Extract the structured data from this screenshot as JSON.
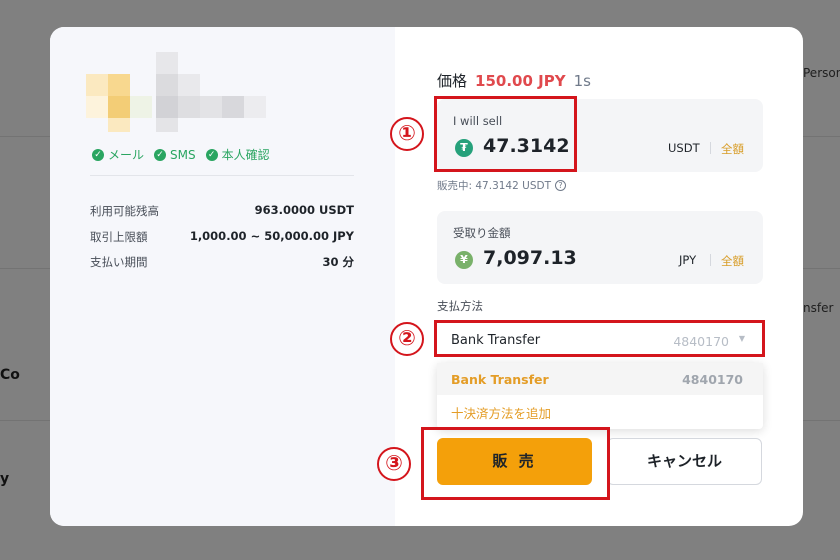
{
  "background": {
    "top_right_text": "Person",
    "mid_right_text": "nsfer",
    "left_text_1": "Co",
    "left_text_2": "y"
  },
  "merchant": {
    "verifications": [
      "メール",
      "SMS",
      "本人確認"
    ],
    "info": [
      {
        "label": "利用可能残高",
        "value": "963.0000 USDT"
      },
      {
        "label": "取引上限額",
        "value": "1,000.00 ~ 50,000.00 JPY"
      },
      {
        "label": "支払い期間",
        "value": "30 分"
      }
    ]
  },
  "price": {
    "label": "価格",
    "value": "150.00 JPY",
    "timer": "1s"
  },
  "sell_field": {
    "label": "I will sell",
    "coin_icon": "tether-icon",
    "amount": "47.3142",
    "unit": "USDT",
    "all_label": "全額",
    "hint": "販売中: 47.3142 USDT"
  },
  "receive_field": {
    "label": "受取り金額",
    "coin_icon": "yen-icon",
    "amount": "7,097.13",
    "unit": "JPY",
    "all_label": "全額"
  },
  "payment": {
    "label": "支払方法",
    "selected_name": "Bank Transfer",
    "selected_number": "4840170",
    "options": [
      {
        "name": "Bank Transfer",
        "number": "4840170"
      }
    ],
    "add_label": "十決済方法を追加"
  },
  "actions": {
    "sell": "販 売",
    "cancel": "キャンセル"
  },
  "annotations": [
    "①",
    "②",
    "③"
  ],
  "colors": {
    "accent": "#f4a00a",
    "price": "#e0494d",
    "verified": "#2aa561",
    "annotation": "#d4151c"
  }
}
